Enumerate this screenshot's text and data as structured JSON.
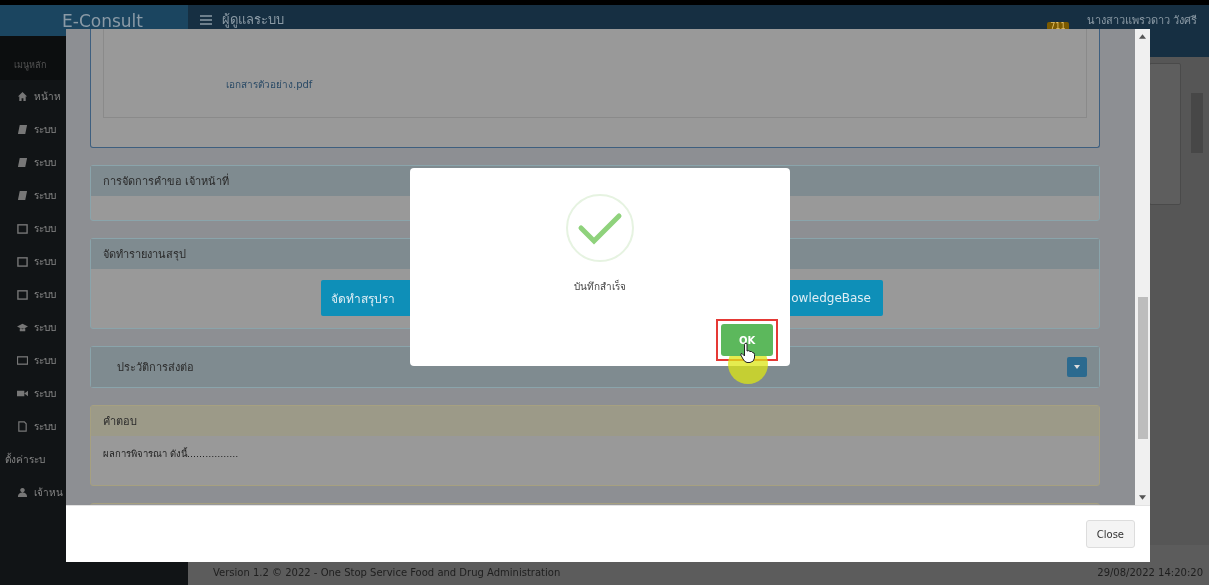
{
  "app": {
    "brand": "E-Consult",
    "header_title": "ผู้ดูแลระบบ",
    "notification_count": "711",
    "user_name": "นางสาวแพรวดาว วังศรี"
  },
  "sidebar": {
    "heading": "เมนูหลัก",
    "items": [
      {
        "kind": "home",
        "label": "หน้าห"
      },
      {
        "kind": "book",
        "label": "ระบบ"
      },
      {
        "kind": "book",
        "label": "ระบบ"
      },
      {
        "kind": "book",
        "label": "ระบบ"
      },
      {
        "kind": "calendar",
        "label": "ระบบ"
      },
      {
        "kind": "calendar",
        "label": "ระบบ"
      },
      {
        "kind": "calendar",
        "label": "ระบบ"
      },
      {
        "kind": "cap",
        "label": "ระบบ"
      },
      {
        "kind": "card",
        "label": "ระบบ"
      },
      {
        "kind": "video",
        "label": "ระบบ"
      },
      {
        "kind": "file",
        "label": "ระบบ"
      },
      {
        "kind": "section",
        "label": "ตั้งค่าระบ"
      },
      {
        "kind": "user",
        "label": "เจ้าหน"
      }
    ]
  },
  "footer": {
    "version": "Version 1.2 © 2022 - One Stop Service Food and Drug Administration",
    "datetime": "29/08/2022 14:20:20"
  },
  "modal": {
    "attachment": "เอกสารตัวอย่าง.pdf",
    "panels": [
      {
        "kind": "info",
        "title": "การจัดการคำขอ เจ้าหน้าที่"
      },
      {
        "kind": "info",
        "title": "จัดทำรายงานสรุป",
        "buttons": [
          "จัดทำสรุปรา",
          "owledgeBase"
        ]
      },
      {
        "kind": "collapsible",
        "title": "ประวัติการส่งต่อ",
        "expanded": false
      },
      {
        "kind": "warning",
        "title": "คำตอบ",
        "text": "ผลการพิจารณา ดังนี้................."
      }
    ],
    "close_button": "Close"
  },
  "dialog": {
    "message": "บันทึกสำเร็จ",
    "confirm_button": "OK"
  }
}
